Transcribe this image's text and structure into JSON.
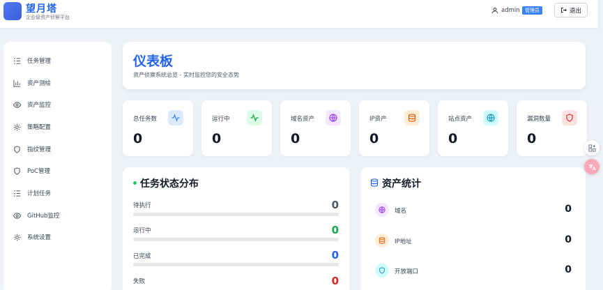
{
  "app": {
    "name": "望月塔",
    "tagline": "企业级资产侦察平台"
  },
  "user": {
    "name": "admin",
    "role": "管理员",
    "logout_label": "退出"
  },
  "sidebar": {
    "items": [
      {
        "label": "任务管理",
        "icon": "task-list-icon"
      },
      {
        "label": "资产测绘",
        "icon": "bar-chart-icon"
      },
      {
        "label": "资产监控",
        "icon": "eye-icon"
      },
      {
        "label": "策略配置",
        "icon": "gear-icon"
      },
      {
        "label": "指纹管理",
        "icon": "shield-icon"
      },
      {
        "label": "PoC管理",
        "icon": "shield-icon"
      },
      {
        "label": "计划任务",
        "icon": "task-list-icon"
      },
      {
        "label": "GitHub监控",
        "icon": "eye-icon"
      },
      {
        "label": "系统设置",
        "icon": "gear-icon"
      }
    ]
  },
  "dashboard": {
    "title": "仪表板",
    "subtitle": "资产侦察系统总览 - 实时监控您的安全态势"
  },
  "stats": [
    {
      "label": "总任务数",
      "value": "0",
      "icon": "activity-icon",
      "color": "#3b82f6",
      "bg": "#dbeafe"
    },
    {
      "label": "运行中",
      "value": "0",
      "icon": "activity-icon",
      "color": "#16a34a",
      "bg": "#dcfce7"
    },
    {
      "label": "域名资产",
      "value": "0",
      "icon": "globe-icon",
      "color": "#9333ea",
      "bg": "#f3e8ff"
    },
    {
      "label": "IP资产",
      "value": "0",
      "icon": "database-icon",
      "color": "#ea580c",
      "bg": "#ffedd5"
    },
    {
      "label": "站点资产",
      "value": "0",
      "icon": "globe-icon",
      "color": "#0891b2",
      "bg": "#cffafe"
    },
    {
      "label": "漏洞数量",
      "value": "0",
      "icon": "shield-icon",
      "color": "#dc2626",
      "bg": "#fee2e2"
    }
  ],
  "task_status": {
    "title": "任务状态分布",
    "rows": [
      {
        "label": "待执行",
        "value": "0",
        "color": "#4b5563"
      },
      {
        "label": "运行中",
        "value": "0",
        "color": "#16a34a"
      },
      {
        "label": "已完成",
        "value": "0",
        "color": "#2563eb"
      },
      {
        "label": "失败",
        "value": "0",
        "color": "#dc2626"
      }
    ]
  },
  "asset_stats": {
    "title": "资产统计",
    "rows": [
      {
        "label": "域名",
        "value": "0",
        "icon": "globe-icon",
        "color": "#9333ea",
        "bg": "#f3e8ff"
      },
      {
        "label": "IP地址",
        "value": "0",
        "icon": "database-icon",
        "color": "#ea580c",
        "bg": "#ffedd5"
      },
      {
        "label": "开放端口",
        "value": "0",
        "icon": "shield-icon",
        "color": "#0891b2",
        "bg": "#cffafe"
      }
    ]
  }
}
